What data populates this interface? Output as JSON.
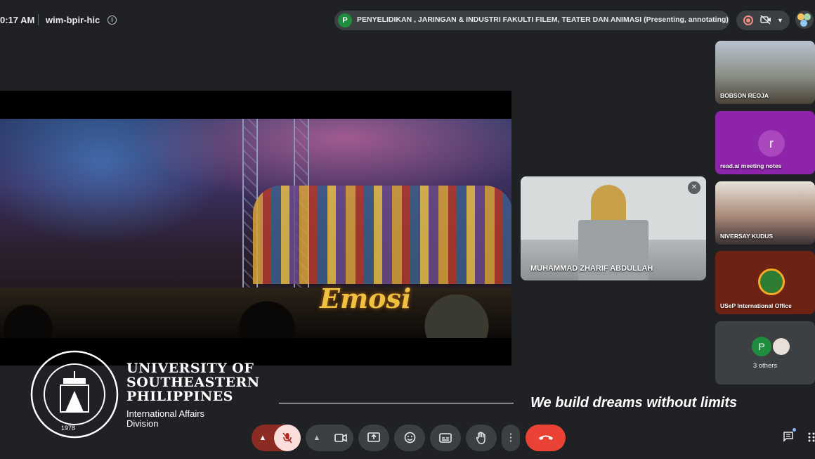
{
  "topbar": {
    "time": "0:17 AM",
    "meeting_code": "wim-bpir-hic",
    "info_icon": "info-icon",
    "presenter_initial": "P",
    "presenting_text": "PENYELIDIKAN , JARINGAN & INDUSTRI FAKULTI FILEM, TEATER DAN ANIMASI (Presenting, annotating)"
  },
  "shared_screen": {
    "sign_text": "Emosi"
  },
  "speaker": {
    "name": "MUHAMMAD ZHARIF ABDULLAH",
    "muted_icon": "mic-off-icon"
  },
  "participants": [
    {
      "name": "BOBSON REOJA"
    },
    {
      "name": "read.ai meeting notes",
      "initial": "r"
    },
    {
      "name": "NIVERSAY KUDUS"
    },
    {
      "name": "USeP International Office"
    },
    {
      "initial": "P",
      "others": "3 others"
    }
  ],
  "branding": {
    "seal_top": "UNIVERSITY OF SOUTHEASTERN PHILIPPINES",
    "seal_year": "1978",
    "name_line1": "UNIVERSITY OF",
    "name_line2": "SOUTHEASTERN",
    "name_line3": "PHILIPPINES",
    "division_line1": "International Affairs",
    "division_line2": "Division",
    "tagline": "We build dreams without limits"
  },
  "controls": {
    "mic_icon": "mic-off-icon",
    "camera_icon": "videocam-icon",
    "present_icon": "present-screen-icon",
    "emoji_icon": "emoji-icon",
    "captions_icon": "captions-icon",
    "hand_icon": "raise-hand-icon",
    "more_icon": "more-vert-icon",
    "end_icon": "end-call-icon",
    "chat_icon": "chat-icon",
    "apps_icon": "apps-icon"
  },
  "colors": {
    "background": "#202124",
    "end_call": "#ea4335",
    "mic_muted_bg": "#8c2b23"
  }
}
